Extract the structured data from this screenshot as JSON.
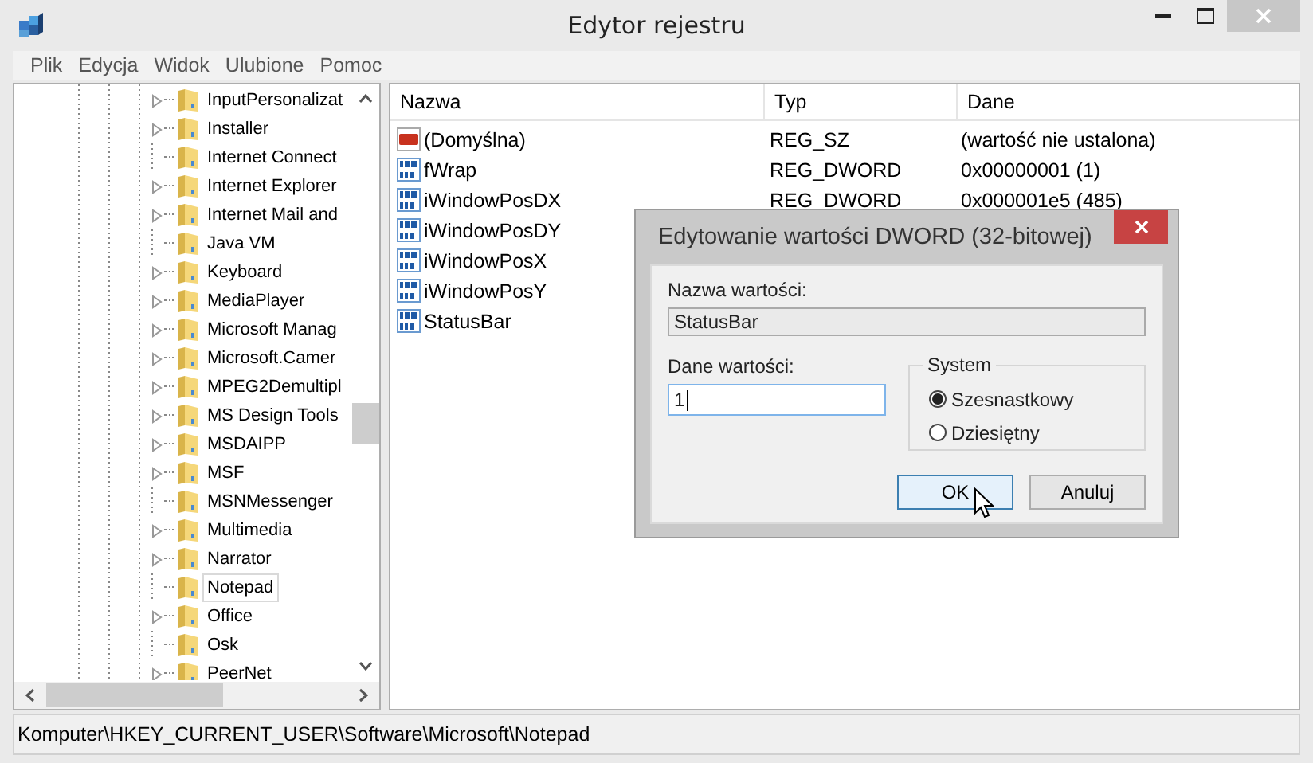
{
  "window": {
    "title": "Edytor rejestru"
  },
  "menu": [
    "Plik",
    "Edycja",
    "Widok",
    "Ulubione",
    "Pomoc"
  ],
  "tree": {
    "items": [
      {
        "label": "InputPersonalizat",
        "expandable": true,
        "selected": false
      },
      {
        "label": "Installer",
        "expandable": true,
        "selected": false
      },
      {
        "label": "Internet Connect",
        "expandable": false,
        "selected": false
      },
      {
        "label": "Internet Explorer",
        "expandable": true,
        "selected": false
      },
      {
        "label": "Internet Mail and",
        "expandable": true,
        "selected": false
      },
      {
        "label": "Java VM",
        "expandable": false,
        "selected": false
      },
      {
        "label": "Keyboard",
        "expandable": true,
        "selected": false
      },
      {
        "label": "MediaPlayer",
        "expandable": true,
        "selected": false
      },
      {
        "label": "Microsoft Manag",
        "expandable": true,
        "selected": false
      },
      {
        "label": "Microsoft.Camer",
        "expandable": true,
        "selected": false
      },
      {
        "label": "MPEG2Demultipl",
        "expandable": true,
        "selected": false
      },
      {
        "label": "MS Design Tools",
        "expandable": true,
        "selected": false
      },
      {
        "label": "MSDAIPP",
        "expandable": true,
        "selected": false
      },
      {
        "label": "MSF",
        "expandable": true,
        "selected": false
      },
      {
        "label": "MSNMessenger",
        "expandable": false,
        "selected": false
      },
      {
        "label": "Multimedia",
        "expandable": true,
        "selected": false
      },
      {
        "label": "Narrator",
        "expandable": true,
        "selected": false
      },
      {
        "label": "Notepad",
        "expandable": false,
        "selected": true
      },
      {
        "label": "Office",
        "expandable": true,
        "selected": false
      },
      {
        "label": "Osk",
        "expandable": false,
        "selected": false
      },
      {
        "label": "PeerNet",
        "expandable": true,
        "selected": false
      }
    ]
  },
  "table": {
    "columns": [
      "Nazwa",
      "Typ",
      "Dane"
    ],
    "rows": [
      {
        "kind": "string",
        "name": "(Domyślna)",
        "type": "REG_SZ",
        "data": "(wartość nie ustalona)"
      },
      {
        "kind": "dword",
        "name": "fWrap",
        "type": "REG_DWORD",
        "data": "0x00000001 (1)"
      },
      {
        "kind": "dword",
        "name": "iWindowPosDX",
        "type": "REG_DWORD",
        "data": "0x000001e5 (485)"
      },
      {
        "kind": "dword",
        "name": "iWindowPosDY"
      },
      {
        "kind": "dword",
        "name": "iWindowPosX"
      },
      {
        "kind": "dword",
        "name": "iWindowPosY"
      },
      {
        "kind": "dword",
        "name": "StatusBar"
      }
    ]
  },
  "status_bar": "Komputer\\HKEY_CURRENT_USER\\Software\\Microsoft\\Notepad",
  "dialog": {
    "title": "Edytowanie wartości DWORD (32-bitowej)",
    "name_label": "Nazwa wartości:",
    "name_value": "StatusBar",
    "data_label": "Dane wartości:",
    "data_value": "1",
    "group_title": "System",
    "radios": [
      {
        "label": "Szesnastkowy",
        "selected": true
      },
      {
        "label": "Dziesiętny",
        "selected": false
      }
    ],
    "buttons": [
      {
        "label": "OK",
        "kind": "default"
      },
      {
        "label": "Anuluj",
        "kind": "normal"
      }
    ]
  }
}
